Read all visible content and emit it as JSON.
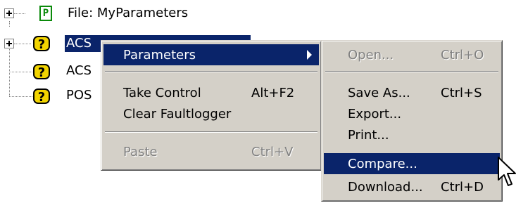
{
  "tree": {
    "file_icon_glyph": "P",
    "file_label": "File: MyParameters",
    "items": [
      {
        "label": "ACS"
      },
      {
        "label": "ACS"
      },
      {
        "label": "POS"
      }
    ]
  },
  "context_menu": {
    "parameters_label": "Parameters",
    "take_control_label": "Take Control",
    "take_control_shortcut": "Alt+F2",
    "clear_faultlogger_label": "Clear Faultlogger",
    "paste_label": "Paste",
    "paste_shortcut": "Ctrl+V"
  },
  "submenu": {
    "open_label": "Open...",
    "open_shortcut": "Ctrl+O",
    "save_as_label": "Save As...",
    "save_as_shortcut": "Ctrl+S",
    "export_label": "Export...",
    "print_label": "Print...",
    "compare_label": "Compare...",
    "download_label": "Download...",
    "download_shortcut": "Ctrl+D"
  },
  "colors": {
    "menu_background": "#d4d0c8",
    "highlight": "#0a246a",
    "disabled_text": "#808080",
    "file_icon": "#0a8a0a",
    "question_icon": "#f2d400"
  },
  "icons": {
    "file": "parameter-file-icon",
    "unknown_device": "question-mark-icon",
    "submenu_arrow": "triangle-right-icon",
    "cursor": "mouse-pointer-icon"
  }
}
